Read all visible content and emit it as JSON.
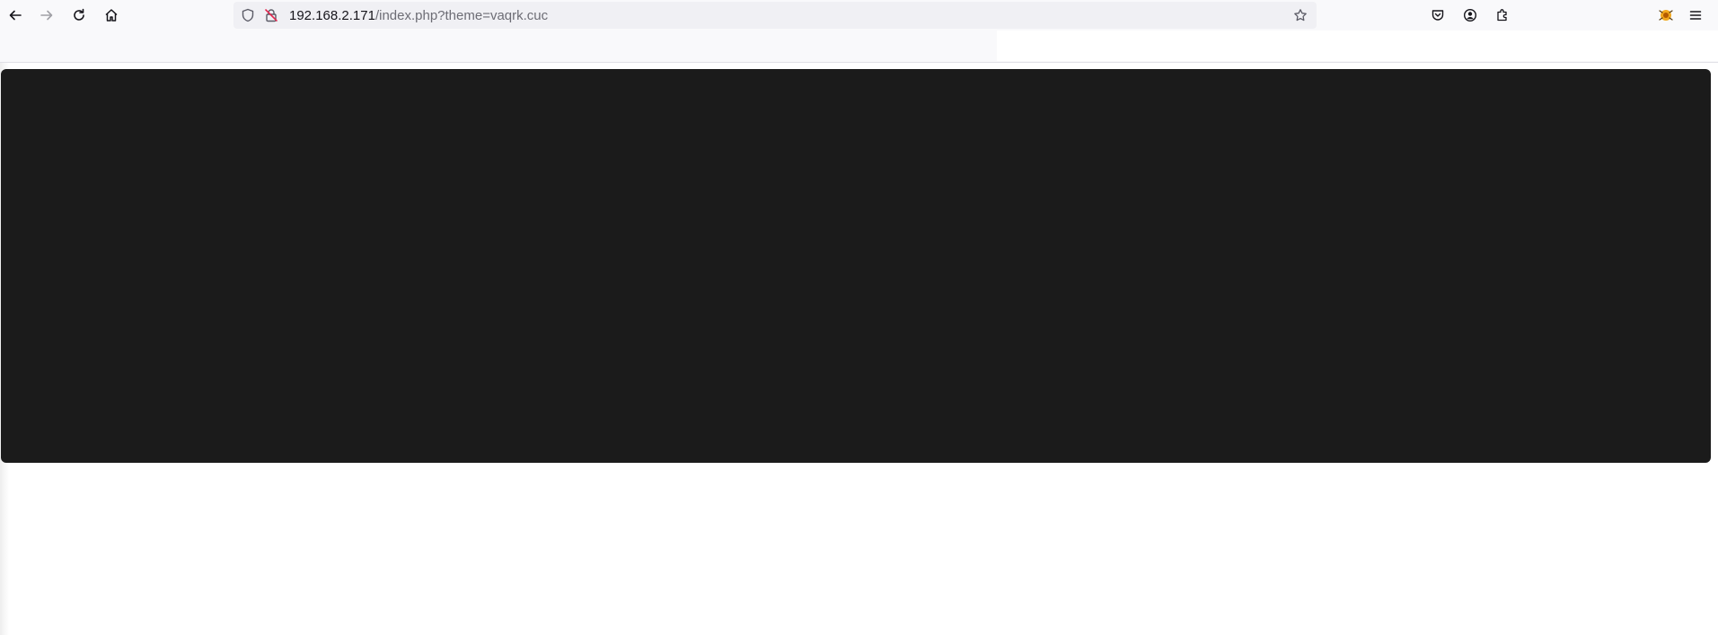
{
  "browser": {
    "url_host": "192.168.2.171",
    "url_path": "/index.php?theme=vaqrk.cuc",
    "icons": {
      "back": "arrow-left-icon",
      "forward": "arrow-right-icon",
      "reload": "reload-icon",
      "home": "home-icon",
      "tracking_protection": "shield-icon",
      "connection": "insecure-lock-icon",
      "bookmark": "star-icon",
      "pocket": "pocket-icon",
      "account": "account-icon",
      "extensions": "puzzle-icon",
      "extension_item": "extension-icon",
      "menu": "hamburger-menu-icon"
    }
  },
  "page": {
    "panel_color": "#1b1b1b",
    "background_color": "#ffffff"
  }
}
